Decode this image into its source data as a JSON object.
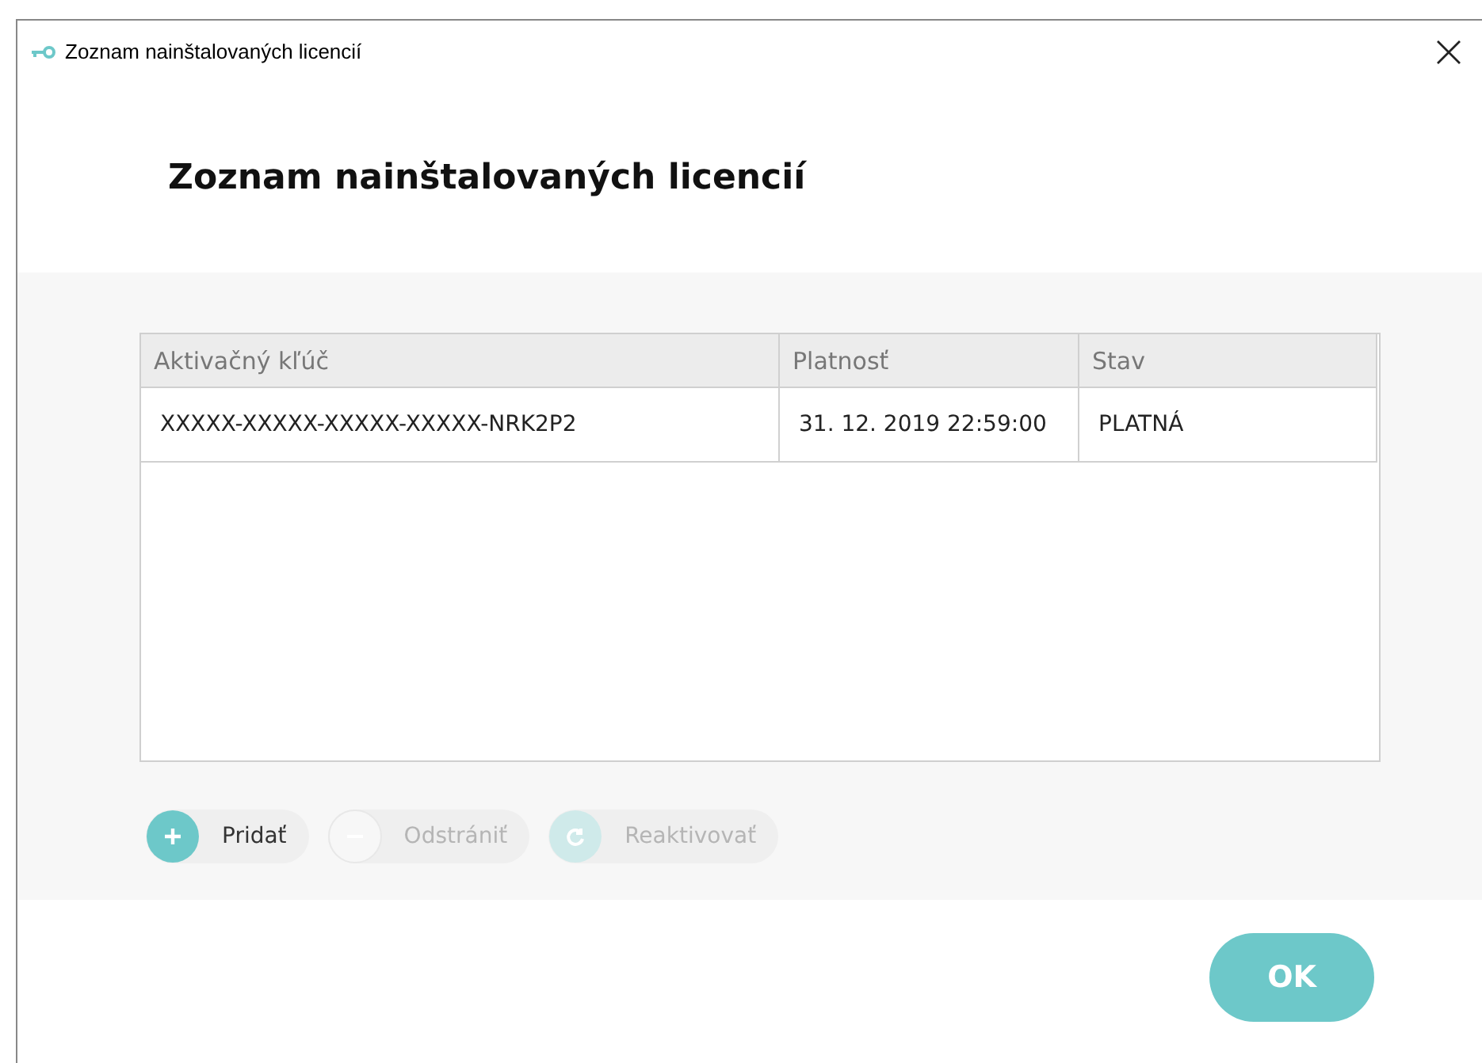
{
  "window": {
    "title": "Zoznam nainštalovaných licencií"
  },
  "heading": "Zoznam nainštalovaných licencií",
  "table": {
    "columns": [
      "Aktivačný kľúč",
      "Platnosť",
      "Stav"
    ],
    "rows": [
      {
        "cells": [
          "XXXXX-XXXXX-XXXXX-XXXXX-NRK2P2",
          "31. 12. 2019 22:59:00",
          "PLATNÁ"
        ],
        "selected": false
      }
    ]
  },
  "actions": [
    {
      "kind": "add",
      "label": "Pridať",
      "disabled": false
    },
    {
      "kind": "remove",
      "label": "Odstrániť",
      "disabled": true
    },
    {
      "kind": "reactivate",
      "label": "Reaktivovať",
      "disabled": true
    }
  ],
  "buttons": [
    {
      "label": "OK"
    }
  ]
}
